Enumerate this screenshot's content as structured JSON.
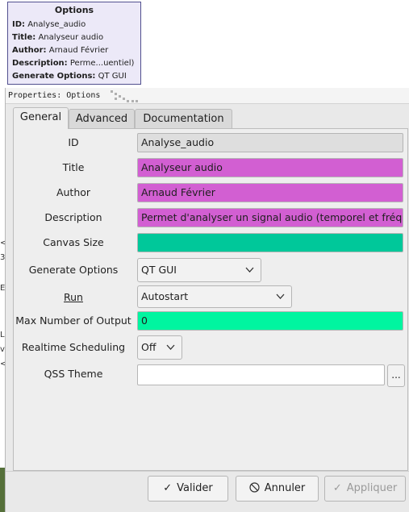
{
  "block": {
    "title": "Options",
    "lines": [
      {
        "key": "ID:",
        "value": "Analyse_audio"
      },
      {
        "key": "Title:",
        "value": "Analyseur audio"
      },
      {
        "key": "Author:",
        "value": "Arnaud Février"
      },
      {
        "key": "Description:",
        "value": "Perme...uentiel)"
      },
      {
        "key": "Generate Options:",
        "value": "QT GUI"
      }
    ]
  },
  "dialog": {
    "title": "Properties: Options",
    "tabs": [
      "General",
      "Advanced",
      "Documentation"
    ],
    "fields": {
      "id": {
        "label": "ID",
        "value": "Analyse_audio"
      },
      "title": {
        "label": "Title",
        "value": "Analyseur audio"
      },
      "author": {
        "label": "Author",
        "value": "Arnaud Février"
      },
      "description": {
        "label": "Description",
        "value": "Permet d'analyser un signal audio (temporel et fréq"
      },
      "canvas_size": {
        "label": "Canvas Size",
        "value": ""
      },
      "generate_options": {
        "label": "Generate Options",
        "value": "QT GUI"
      },
      "run": {
        "label": "Run",
        "value": "Autostart"
      },
      "max_outputs": {
        "label": "Max Number of Output",
        "value": "0"
      },
      "realtime": {
        "label": "Realtime Scheduling",
        "value": "Off"
      },
      "qss_theme": {
        "label": "QSS Theme",
        "value": ""
      },
      "browse_label": "..."
    },
    "buttons": {
      "ok": "Valider",
      "cancel": "Annuler",
      "apply": "Appliquer"
    }
  },
  "background_fragments": [
    "<",
    "3",
    "E",
    "L",
    "v",
    "<"
  ],
  "colors": {
    "pink_field": "#d25fd2",
    "teal_field": "#00c89a",
    "green_field": "#00f5a0",
    "block_border": "#51508f"
  }
}
